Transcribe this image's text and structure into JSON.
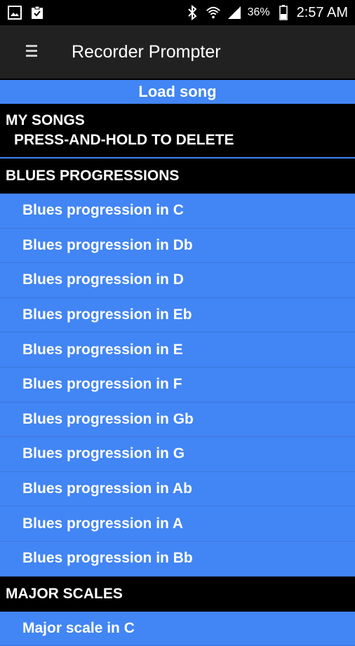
{
  "status_bar": {
    "battery_percent": "36%",
    "time": "2:57 AM",
    "icons": [
      "image-icon",
      "clipboard-check-icon",
      "bluetooth-icon",
      "wifi-icon",
      "signal-icon",
      "battery-icon"
    ]
  },
  "app_bar": {
    "title": "Recorder Prompter",
    "menu_icon": "hamburger-menu-icon"
  },
  "load_song": {
    "label": "Load song"
  },
  "my_songs": {
    "title": "MY SONGS",
    "subtitle": "PRESS-AND-HOLD TO DELETE"
  },
  "blues": {
    "header": "BLUES PROGRESSIONS",
    "items": [
      "Blues progression in C",
      "Blues progression in Db",
      "Blues progression in D",
      "Blues progression in Eb",
      "Blues progression in E",
      "Blues progression in F",
      "Blues progression in Gb",
      "Blues progression in G",
      "Blues progression in Ab",
      "Blues progression in A",
      "Blues progression in Bb"
    ]
  },
  "major": {
    "header": "MAJOR SCALES",
    "items": [
      "Major scale in C"
    ]
  },
  "colors": {
    "accent": "#4285f4",
    "app_bar": "#212121",
    "background": "#000000"
  }
}
